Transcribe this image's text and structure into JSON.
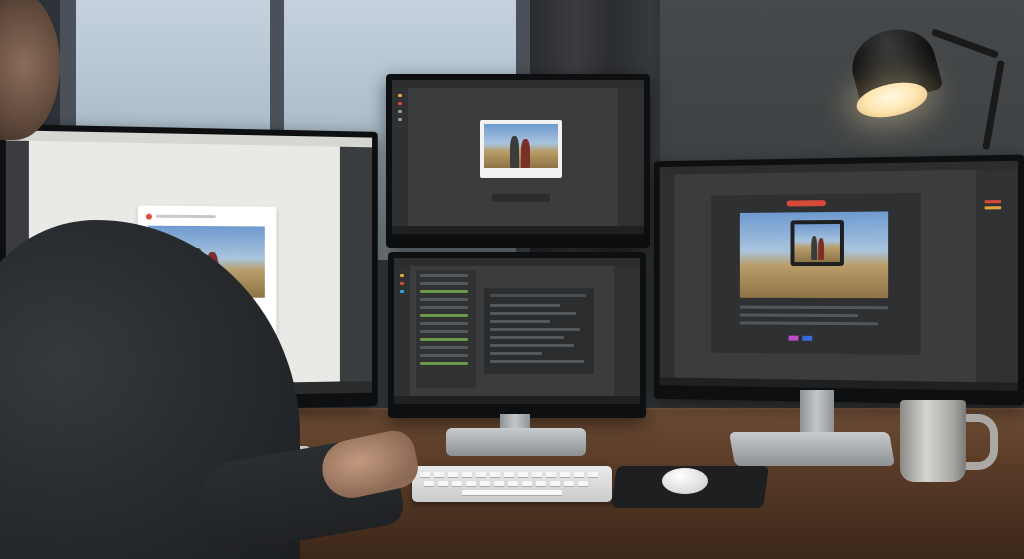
{
  "scene": {
    "description_tags": [
      "workspace",
      "three-monitors",
      "photo-editing"
    ],
    "colors": {
      "wall": "#3a4047",
      "desk": "#5a3c28",
      "screen_dark": "#3a3c3e",
      "screen_light": "#e9e9e6",
      "lamp_glow": "#ffe6b0"
    }
  },
  "monitors": {
    "left": {
      "theme": "light"
    },
    "center_top": {
      "theme": "dark"
    },
    "center_bottom": {
      "theme": "dark"
    },
    "right": {
      "theme": "dark"
    }
  },
  "icons": {
    "lamp": "desk-lamp-icon",
    "mug": "coffee-mug-icon",
    "keyboard": "keyboard-icon",
    "mouse": "mouse-icon"
  }
}
